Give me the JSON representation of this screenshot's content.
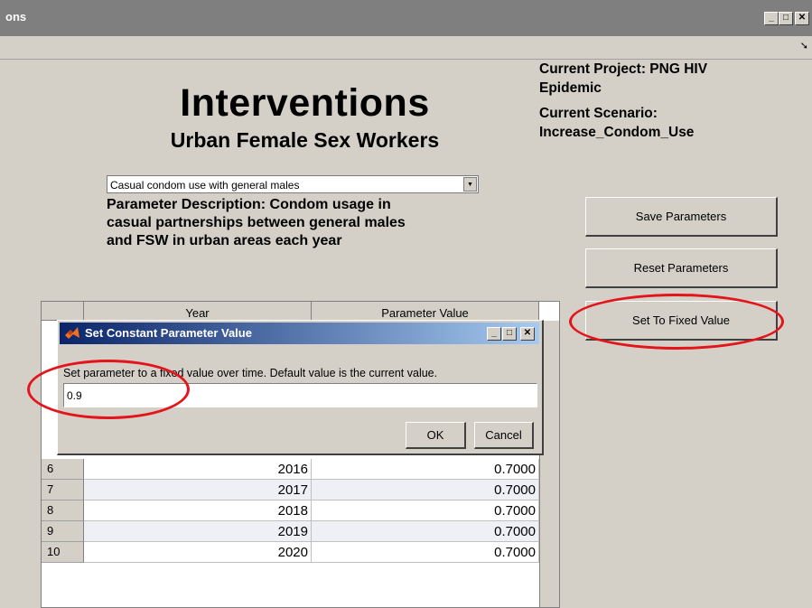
{
  "window": {
    "title": "ons",
    "controls": {
      "minimize": "_",
      "maximize": "□",
      "close": "✕"
    }
  },
  "header": {
    "title": "Interventions",
    "subtitle": "Urban Female Sex Workers"
  },
  "project_info": {
    "line1": "Current Project: PNG HIV",
    "line2": "Epidemic",
    "line3": "Current Scenario:",
    "line4": "Increase_Condom_Use"
  },
  "parameter_select": {
    "selected": "Casual condom use with general males"
  },
  "description": {
    "line1": "Parameter Description: Condom usage in",
    "line2": "casual partnerships between general males",
    "line3": "and FSW in urban areas each year"
  },
  "buttons": {
    "save": "Save Parameters",
    "reset": "Reset Parameters",
    "fixed": "Set To Fixed Value"
  },
  "table": {
    "columns": [
      "Year",
      "Parameter Value"
    ],
    "rows": [
      {
        "idx": "6",
        "year": "2016",
        "value": "0.7000"
      },
      {
        "idx": "7",
        "year": "2017",
        "value": "0.7000"
      },
      {
        "idx": "8",
        "year": "2018",
        "value": "0.7000"
      },
      {
        "idx": "9",
        "year": "2019",
        "value": "0.7000"
      },
      {
        "idx": "10",
        "year": "2020",
        "value": "0.7000"
      }
    ]
  },
  "dialog": {
    "title": "Set Constant Parameter Value",
    "prompt": "Set parameter to a fixed value over time. Default value is the current value.",
    "input_value": "0.9",
    "ok": "OK",
    "cancel": "Cancel"
  },
  "colors": {
    "window_bg": "#d4d0c8",
    "highlight_oval": "#e3141a",
    "dialog_title_start": "#0a246a",
    "dialog_title_end": "#a6caf0"
  }
}
